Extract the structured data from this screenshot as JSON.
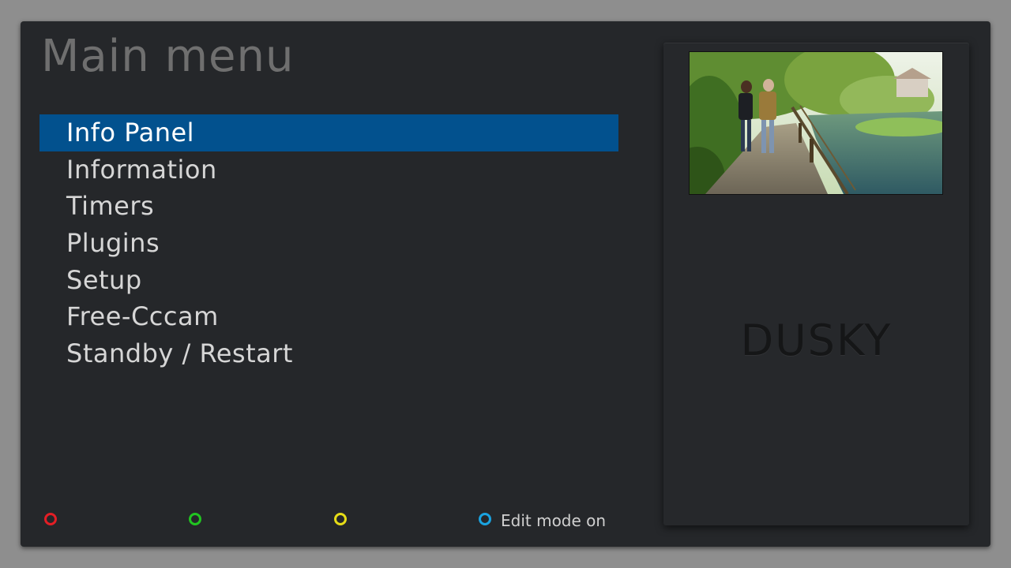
{
  "screen": {
    "title": "Main menu"
  },
  "menu": {
    "items": [
      {
        "label": "Info Panel",
        "selected": true
      },
      {
        "label": "Information",
        "selected": false
      },
      {
        "label": "Timers",
        "selected": false
      },
      {
        "label": "Plugins",
        "selected": false
      },
      {
        "label": "Setup",
        "selected": false
      },
      {
        "label": "Free-Cccam",
        "selected": false
      },
      {
        "label": "Standby / Restart",
        "selected": false
      }
    ]
  },
  "preview": {
    "brand": "DUSKY"
  },
  "footer": {
    "red": {
      "label": "",
      "color": "#e31e25"
    },
    "green": {
      "label": "",
      "color": "#21c421"
    },
    "yellow": {
      "label": "",
      "color": "#e6dc17"
    },
    "blue": {
      "label": "Edit mode on",
      "color": "#1aa3e0"
    }
  },
  "colors": {
    "selection": "#02518e",
    "background": "#25272a"
  }
}
